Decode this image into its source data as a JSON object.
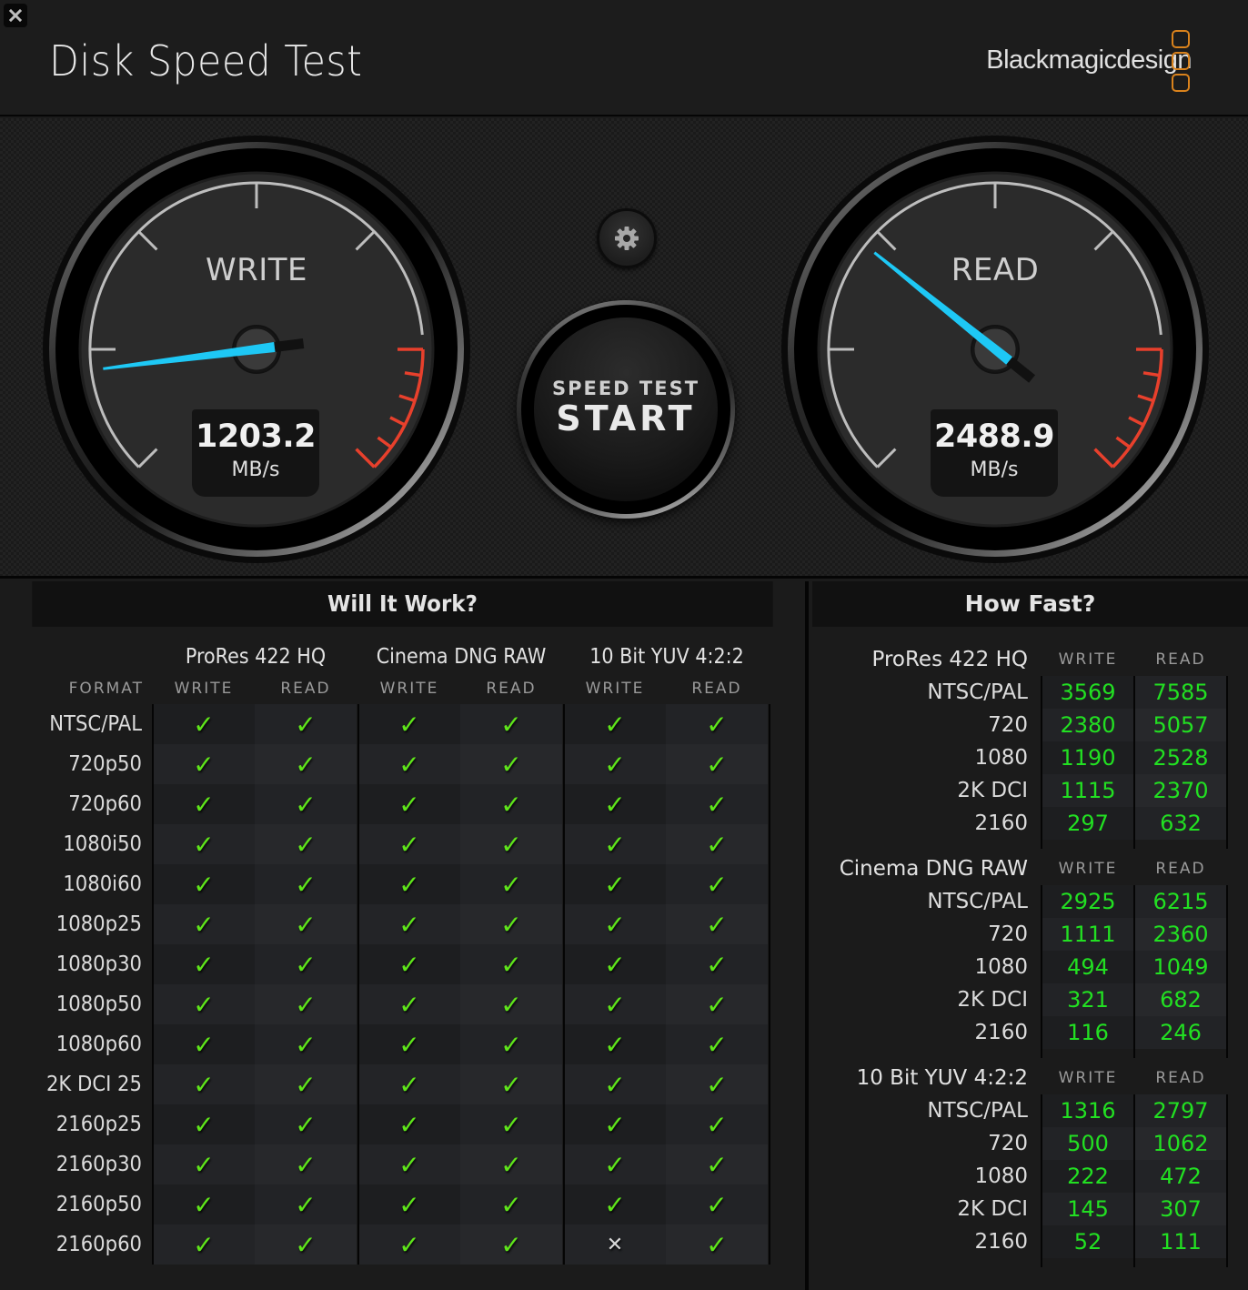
{
  "app": {
    "title": "Disk Speed Test",
    "brand": "Blackmagicdesign",
    "brand_color": "#d9821c",
    "close_icon": "close-icon"
  },
  "gauges": {
    "scale_note": "needle position as fraction of full sweep",
    "write": {
      "label": "WRITE",
      "value": "1203.2",
      "unit": "MB/s",
      "needle_fraction": 0.14
    },
    "read": {
      "label": "READ",
      "value": "2488.9",
      "unit": "MB/s",
      "needle_fraction": 0.31
    },
    "needle_color": "#1ec8f5",
    "redline_color": "#e8402c"
  },
  "controls": {
    "settings_icon": "gear-icon",
    "start_sub": "SPEED TEST",
    "start_main": "START"
  },
  "will_it_work": {
    "title": "Will It Work?",
    "format_header": "FORMAT",
    "codecs": [
      "ProRes 422 HQ",
      "Cinema DNG RAW",
      "10 Bit YUV 4:2:2"
    ],
    "col_headers": [
      "WRITE",
      "READ",
      "WRITE",
      "READ",
      "WRITE",
      "READ"
    ],
    "ok_color": "#5fe61a",
    "rows": [
      {
        "format": "NTSC/PAL",
        "results": [
          true,
          true,
          true,
          true,
          true,
          true
        ]
      },
      {
        "format": "720p50",
        "results": [
          true,
          true,
          true,
          true,
          true,
          true
        ]
      },
      {
        "format": "720p60",
        "results": [
          true,
          true,
          true,
          true,
          true,
          true
        ]
      },
      {
        "format": "1080i50",
        "results": [
          true,
          true,
          true,
          true,
          true,
          true
        ]
      },
      {
        "format": "1080i60",
        "results": [
          true,
          true,
          true,
          true,
          true,
          true
        ]
      },
      {
        "format": "1080p25",
        "results": [
          true,
          true,
          true,
          true,
          true,
          true
        ]
      },
      {
        "format": "1080p30",
        "results": [
          true,
          true,
          true,
          true,
          true,
          true
        ]
      },
      {
        "format": "1080p50",
        "results": [
          true,
          true,
          true,
          true,
          true,
          true
        ]
      },
      {
        "format": "1080p60",
        "results": [
          true,
          true,
          true,
          true,
          true,
          true
        ]
      },
      {
        "format": "2K DCI 25",
        "results": [
          true,
          true,
          true,
          true,
          true,
          true
        ]
      },
      {
        "format": "2160p25",
        "results": [
          true,
          true,
          true,
          true,
          true,
          true
        ]
      },
      {
        "format": "2160p30",
        "results": [
          true,
          true,
          true,
          true,
          true,
          true
        ]
      },
      {
        "format": "2160p50",
        "results": [
          true,
          true,
          true,
          true,
          true,
          true
        ]
      },
      {
        "format": "2160p60",
        "results": [
          true,
          true,
          true,
          true,
          false,
          true
        ]
      }
    ],
    "ok_glyph": "✓",
    "fail_glyph": "✕"
  },
  "how_fast": {
    "title": "How Fast?",
    "write_header": "WRITE",
    "read_header": "READ",
    "value_color": "#22e022",
    "groups": [
      {
        "codec": "ProRes 422 HQ",
        "rows": [
          {
            "res": "NTSC/PAL",
            "write": "3569",
            "read": "7585"
          },
          {
            "res": "720",
            "write": "2380",
            "read": "5057"
          },
          {
            "res": "1080",
            "write": "1190",
            "read": "2528"
          },
          {
            "res": "2K DCI",
            "write": "1115",
            "read": "2370"
          },
          {
            "res": "2160",
            "write": "297",
            "read": "632"
          }
        ]
      },
      {
        "codec": "Cinema DNG RAW",
        "rows": [
          {
            "res": "NTSC/PAL",
            "write": "2925",
            "read": "6215"
          },
          {
            "res": "720",
            "write": "1111",
            "read": "2360"
          },
          {
            "res": "1080",
            "write": "494",
            "read": "1049"
          },
          {
            "res": "2K DCI",
            "write": "321",
            "read": "682"
          },
          {
            "res": "2160",
            "write": "116",
            "read": "246"
          }
        ]
      },
      {
        "codec": "10 Bit YUV 4:2:2",
        "rows": [
          {
            "res": "NTSC/PAL",
            "write": "1316",
            "read": "2797"
          },
          {
            "res": "720",
            "write": "500",
            "read": "1062"
          },
          {
            "res": "1080",
            "write": "222",
            "read": "472"
          },
          {
            "res": "2K DCI",
            "write": "145",
            "read": "307"
          },
          {
            "res": "2160",
            "write": "52",
            "read": "111"
          }
        ]
      }
    ]
  }
}
